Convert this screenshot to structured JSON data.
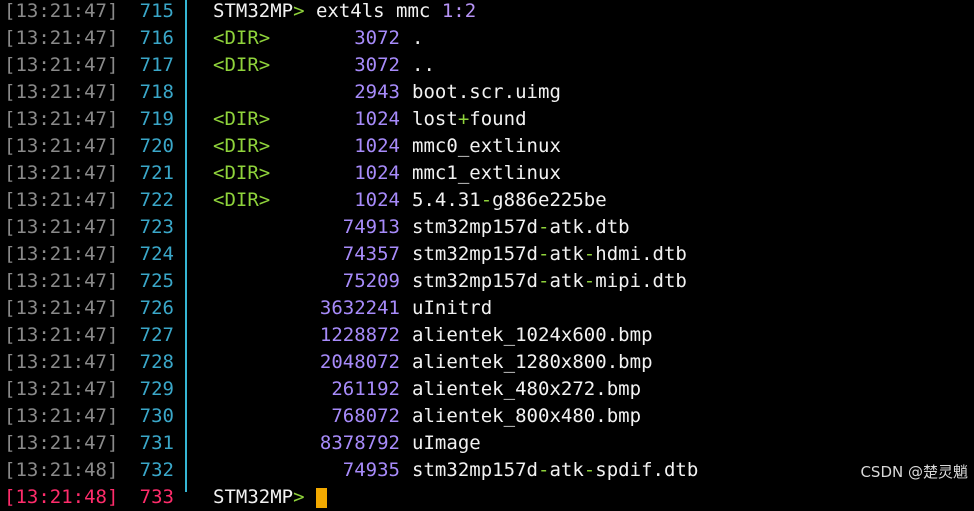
{
  "watermark": "CSDN @楚灵魈",
  "lines": [
    {
      "ts": "[13:21:47]",
      "ln": "715",
      "kind": "cmd",
      "prompt": "STM32MP",
      "gt": ">",
      "cmd": " ext4ls mmc ",
      "num": "1:2"
    },
    {
      "ts": "[13:21:47]",
      "ln": "716",
      "kind": "entry",
      "dir": "<DIR>",
      "size": "3072",
      "name": "."
    },
    {
      "ts": "[13:21:47]",
      "ln": "717",
      "kind": "entry",
      "dir": "<DIR>",
      "size": "3072",
      "name": ".."
    },
    {
      "ts": "[13:21:47]",
      "ln": "718",
      "kind": "entry",
      "dir": "",
      "size": "2943",
      "name": "boot.scr.uimg"
    },
    {
      "ts": "[13:21:47]",
      "ln": "719",
      "kind": "entry",
      "dir": "<DIR>",
      "size": "1024",
      "name": "lost+found"
    },
    {
      "ts": "[13:21:47]",
      "ln": "720",
      "kind": "entry",
      "dir": "<DIR>",
      "size": "1024",
      "name": "mmc0_extlinux"
    },
    {
      "ts": "[13:21:47]",
      "ln": "721",
      "kind": "entry",
      "dir": "<DIR>",
      "size": "1024",
      "name": "mmc1_extlinux"
    },
    {
      "ts": "[13:21:47]",
      "ln": "722",
      "kind": "entry",
      "dir": "<DIR>",
      "size": "1024",
      "name": "5.4.31-g886e225be"
    },
    {
      "ts": "[13:21:47]",
      "ln": "723",
      "kind": "entry",
      "dir": "",
      "size": "74913",
      "name": "stm32mp157d-atk.dtb"
    },
    {
      "ts": "[13:21:47]",
      "ln": "724",
      "kind": "entry",
      "dir": "",
      "size": "74357",
      "name": "stm32mp157d-atk-hdmi.dtb"
    },
    {
      "ts": "[13:21:47]",
      "ln": "725",
      "kind": "entry",
      "dir": "",
      "size": "75209",
      "name": "stm32mp157d-atk-mipi.dtb"
    },
    {
      "ts": "[13:21:47]",
      "ln": "726",
      "kind": "entry",
      "dir": "",
      "size": "3632241",
      "name": "uInitrd"
    },
    {
      "ts": "[13:21:47]",
      "ln": "727",
      "kind": "entry",
      "dir": "",
      "size": "1228872",
      "name": "alientek_1024x600.bmp"
    },
    {
      "ts": "[13:21:47]",
      "ln": "728",
      "kind": "entry",
      "dir": "",
      "size": "2048072",
      "name": "alientek_1280x800.bmp"
    },
    {
      "ts": "[13:21:47]",
      "ln": "729",
      "kind": "entry",
      "dir": "",
      "size": "261192",
      "name": "alientek_480x272.bmp"
    },
    {
      "ts": "[13:21:47]",
      "ln": "730",
      "kind": "entry",
      "dir": "",
      "size": "768072",
      "name": "alientek_800x480.bmp"
    },
    {
      "ts": "[13:21:47]",
      "ln": "731",
      "kind": "entry",
      "dir": "",
      "size": "8378792",
      "name": "uImage"
    },
    {
      "ts": "[13:21:48]",
      "ln": "732",
      "kind": "entry",
      "dir": "",
      "size": "74935",
      "name": "stm32mp157d-atk-spdif.dtb"
    },
    {
      "ts": "[13:21:48]",
      "ln": "733",
      "kind": "cmd",
      "prompt": "STM32MP",
      "gt": ">",
      "cmd": " ",
      "num": "",
      "last": true
    }
  ]
}
